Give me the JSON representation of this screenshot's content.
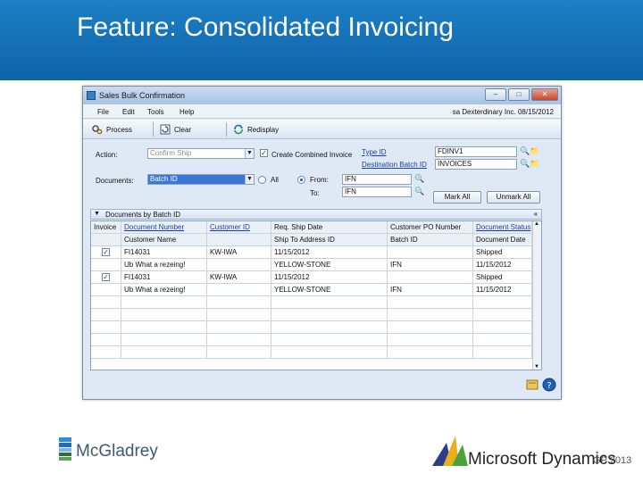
{
  "slide": {
    "title": "Feature: Consolidated Invoicing"
  },
  "window": {
    "title": "Sales Bulk Confirmation",
    "controls": {
      "minimize": "–",
      "maximize": "□",
      "close": "✕"
    }
  },
  "menu": {
    "items": [
      "File",
      "Edit",
      "Tools",
      "Help"
    ],
    "status": "sa  Dexterdinary Inc.  08/15/2012"
  },
  "toolbar": {
    "process_label": "Process",
    "clear_label": "Clear",
    "redisplay_label": "Redisplay"
  },
  "form": {
    "action_label": "Action:",
    "action_value": "Confirm Ship",
    "documents_label": "Documents:",
    "documents_value": "Batch ID",
    "create_combined_label": "Create Combined Invoice",
    "type_id_label": "Type ID",
    "type_id_value": "FDINV1",
    "destination_batch_label": "Destination Batch ID",
    "destination_batch_value": "INVOICES",
    "all_label": "All",
    "from_label": "From:",
    "from_value": "IFN",
    "to_label": "To:",
    "to_value": "IFN",
    "mark_all_label": "Mark All",
    "unmark_all_label": "Unmark All"
  },
  "grid": {
    "title": "Documents by Batch ID",
    "header1": [
      "Invoice",
      "Document Number",
      "Customer ID",
      "Req. Ship Date",
      "Customer PO Number",
      "Document Status"
    ],
    "header2": [
      "",
      "Customer Name",
      "",
      "Ship To Address ID",
      "Batch ID",
      "Document Date"
    ],
    "rows": [
      {
        "checked": true,
        "line1": [
          "",
          "FI14031",
          "KW-IWA",
          "11/15/2012",
          "",
          "Shipped"
        ],
        "line2": [
          "",
          "Ub What a rezeing!",
          "",
          "YELLOW-STONE",
          "IFN",
          "11/15/2012"
        ]
      },
      {
        "checked": true,
        "line1": [
          "",
          "FI14031",
          "KW-IWA",
          "11/15/2012",
          "",
          "Shipped"
        ],
        "line2": [
          "",
          "Ub What a rezeing!",
          "",
          "YELLOW-STONE",
          "IFN",
          "11/15/2012"
        ]
      }
    ]
  },
  "footer": {
    "left_logo_text": "McGladrey",
    "right_logo_text": "Microsoft Dynamics",
    "right_version": "GP 2013"
  },
  "colors": {
    "banner": "#1572b8",
    "window_bg": "#dfe9f5",
    "link": "#1c3fa3"
  }
}
